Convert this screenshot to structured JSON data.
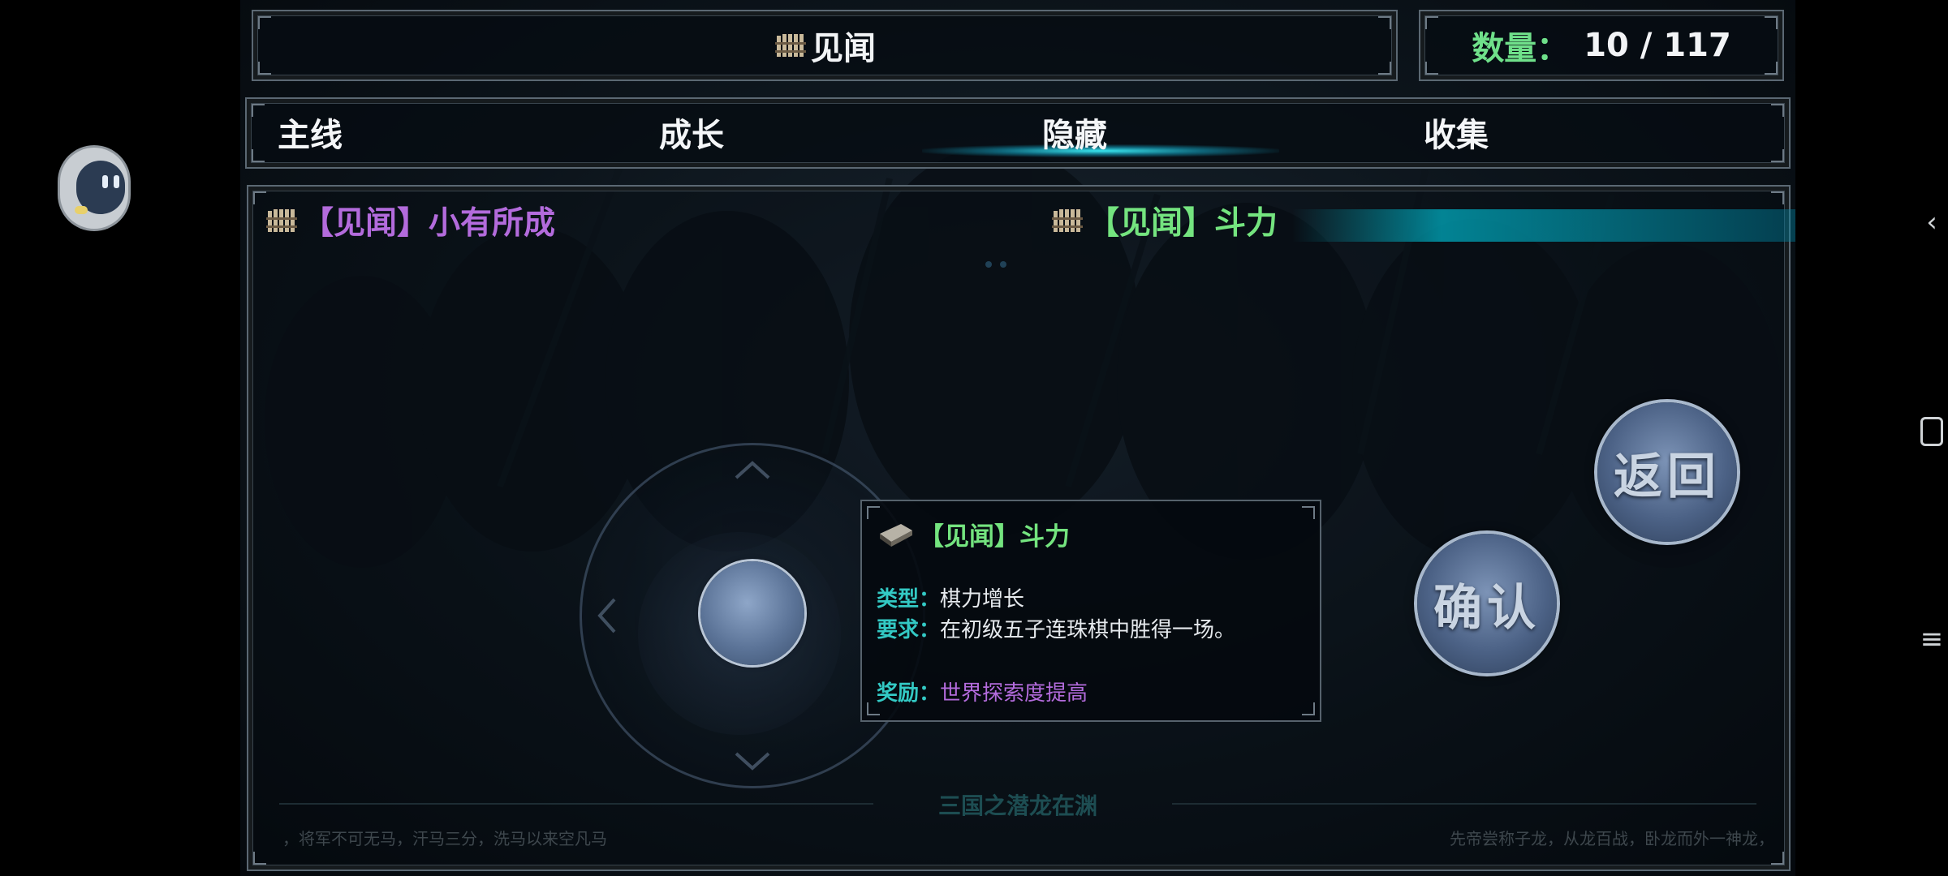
{
  "header": {
    "title": "见闻",
    "count_label": "数量：",
    "count_value": "10 / 117"
  },
  "tabs": [
    {
      "label": "主线",
      "selected": false
    },
    {
      "label": "成长",
      "selected": true
    },
    {
      "label": "隐藏",
      "selected": false
    },
    {
      "label": "收集",
      "selected": false
    }
  ],
  "achievements": [
    {
      "label": "【见闻】小有所成",
      "color": "#b36bdc",
      "selected": false
    },
    {
      "label": "【见闻】斗力",
      "color": "#74e47f",
      "selected": true
    }
  ],
  "detail": {
    "title": "【见闻】斗力",
    "type_key": "类型：",
    "type_value": "棋力增长",
    "req_key": "要求：",
    "req_value": "在初级五子连珠棋中胜得一场。",
    "reward_key": "奖励：",
    "reward_value": "世界探索度提高",
    "reward_color": "#b36bdc"
  },
  "buttons": {
    "back": "返回",
    "confirm": "确认"
  },
  "footer": {
    "center": "三国之潜龙在渊",
    "left": "，将军不可无马，汗马三分，洗马以来空凡马",
    "right": "先帝尝称子龙，从龙百战，卧龙而外一神龙，"
  },
  "colors": {
    "accent_cyan": "#39e6f0",
    "count_green": "#6fe08a",
    "achievement_purple": "#b36bdc",
    "achievement_green": "#74e47f"
  }
}
